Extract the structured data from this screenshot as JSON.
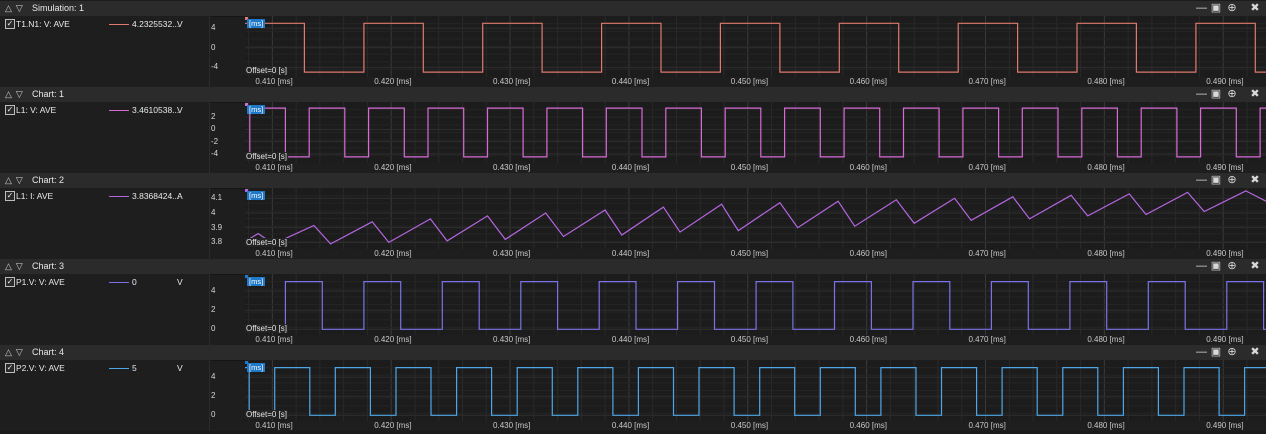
{
  "x_axis": {
    "labels": [
      "0.410 [ms]",
      "0.420 [ms]",
      "0.430 [ms]",
      "0.440 [ms]",
      "0.450 [ms]",
      "0.460 [ms]",
      "0.470 [ms]",
      "0.480 [ms]",
      "0.490 [ms]"
    ],
    "range": [
      0.4077,
      0.4936
    ],
    "unit_box": "[ms]",
    "offset_text": "Offset=0 [s]"
  },
  "panels": [
    {
      "title": "Simulation: 1",
      "signal": "T1.N1: V: AVE",
      "value": "4.2325532...",
      "unit": "V",
      "color": "#e07a6e",
      "cursor_color": "#e07a6e",
      "y_ticks": [
        "4",
        "0",
        "-4"
      ],
      "active": false
    },
    {
      "title": "Chart: 1",
      "signal": "L1: V: AVE",
      "value": "3.4610538...",
      "unit": "V",
      "color": "#d86ad8",
      "cursor_color": "#d86ad8",
      "y_ticks": [
        "2",
        "0",
        "-2",
        "-4"
      ],
      "active": false
    },
    {
      "title": "Chart: 2",
      "signal": "L1: I: AVE",
      "value": "3.8368424...",
      "unit": "A",
      "color": "#b466e0",
      "cursor_color": "#b466e0",
      "y_ticks": [
        "4.1",
        "4",
        "3.9",
        "3.8"
      ],
      "active": false
    },
    {
      "title": "Chart: 3",
      "signal": "P1.V: V: AVE",
      "value": "0",
      "unit": "V",
      "color": "#7a72e6",
      "cursor_color": "#1f78c8",
      "y_ticks": [
        "4",
        "2",
        "0"
      ],
      "active": false
    },
    {
      "title": "Chart: 4",
      "signal": "P2.V: V: AVE",
      "value": "5",
      "unit": "V",
      "color": "#4ea6e6",
      "cursor_color": "#1f78c8",
      "y_ticks": [
        "4",
        "2",
        "0"
      ],
      "active": true
    }
  ],
  "chart_data": [
    {
      "type": "line",
      "title": "Simulation: 1",
      "series": [
        {
          "name": "T1.N1: V: AVE",
          "unit": "V",
          "shape": "square",
          "levels": [
            -5,
            5
          ],
          "period_ms": 0.01,
          "phase_ms": 0.4077,
          "start_level": 5
        }
      ],
      "x": "time [ms]",
      "xlim": [
        0.4077,
        0.4936
      ],
      "ylim": [
        -6,
        6.5
      ],
      "yticks": [
        4,
        0,
        -4
      ]
    },
    {
      "type": "line",
      "title": "Chart: 1",
      "series": [
        {
          "name": "L1: V: AVE",
          "unit": "V",
          "shape": "pulse",
          "high": 3.5,
          "low": -4.5,
          "period_ms": 0.005,
          "high_duty": 0.6,
          "phase_ms": 0.4081
        }
      ],
      "x": "time [ms]",
      "xlim": [
        0.4077,
        0.4936
      ],
      "ylim": [
        -5.5,
        4.5
      ],
      "yticks": [
        2,
        0,
        -2,
        -4
      ]
    },
    {
      "type": "line",
      "title": "Chart: 2",
      "series": [
        {
          "name": "L1: I: AVE",
          "unit": "A",
          "shape": "triangle",
          "points": [
            [
              0.4077,
              3.806
            ],
            [
              0.4088,
              3.86
            ],
            [
              0.4101,
              3.79
            ],
            [
              0.4135,
              3.915
            ],
            [
              0.4149,
              3.79
            ],
            [
              0.4184,
              3.94
            ],
            [
              0.4198,
              3.8
            ],
            [
              0.4233,
              3.96
            ],
            [
              0.4247,
              3.81
            ],
            [
              0.4281,
              3.98
            ],
            [
              0.4296,
              3.82
            ],
            [
              0.433,
              4.0
            ],
            [
              0.4345,
              3.84
            ],
            [
              0.438,
              4.02
            ],
            [
              0.4394,
              3.85
            ],
            [
              0.4429,
              4.04
            ],
            [
              0.4443,
              3.87
            ],
            [
              0.4478,
              4.06
            ],
            [
              0.4492,
              3.88
            ],
            [
              0.4527,
              4.07
            ],
            [
              0.4542,
              3.9
            ],
            [
              0.4576,
              4.08
            ],
            [
              0.459,
              3.91
            ],
            [
              0.4625,
              4.09
            ],
            [
              0.464,
              3.93
            ],
            [
              0.4674,
              4.1
            ],
            [
              0.4688,
              3.95
            ],
            [
              0.4723,
              4.11
            ],
            [
              0.4737,
              3.96
            ],
            [
              0.4772,
              4.12
            ],
            [
              0.4786,
              3.98
            ],
            [
              0.4821,
              4.13
            ],
            [
              0.4835,
              3.99
            ],
            [
              0.487,
              4.14
            ],
            [
              0.4884,
              4.01
            ],
            [
              0.4919,
              4.15
            ],
            [
              0.4936,
              4.08
            ]
          ]
        }
      ],
      "x": "time [ms]",
      "xlim": [
        0.4077,
        0.4936
      ],
      "ylim": [
        3.755,
        4.17
      ],
      "yticks": [
        4.1,
        4,
        3.9,
        3.8
      ]
    },
    {
      "type": "line",
      "title": "Chart: 3",
      "series": [
        {
          "name": "P1.V: V: AVE",
          "unit": "V",
          "shape": "pulse",
          "high": 5,
          "low": 0,
          "period_ms": 0.0066,
          "high_ms": 0.0031,
          "phase_ms": 0.4111
        }
      ],
      "x": "time [ms]",
      "xlim": [
        0.4077,
        0.4936
      ],
      "ylim": [
        -0.6,
        5.8
      ],
      "yticks": [
        4,
        2,
        0
      ]
    },
    {
      "type": "line",
      "title": "Chart: 4",
      "series": [
        {
          "name": "P2.V: V: AVE",
          "unit": "V",
          "shape": "pulse",
          "high": 5,
          "low": 0,
          "period_ms": 0.0051,
          "high_ms": 0.00295,
          "phase_ms": 0.4153
        }
      ],
      "x": "time [ms]",
      "xlim": [
        0.4077,
        0.4936
      ],
      "ylim": [
        -0.6,
        5.8
      ],
      "yticks": [
        4,
        2,
        0
      ]
    }
  ]
}
